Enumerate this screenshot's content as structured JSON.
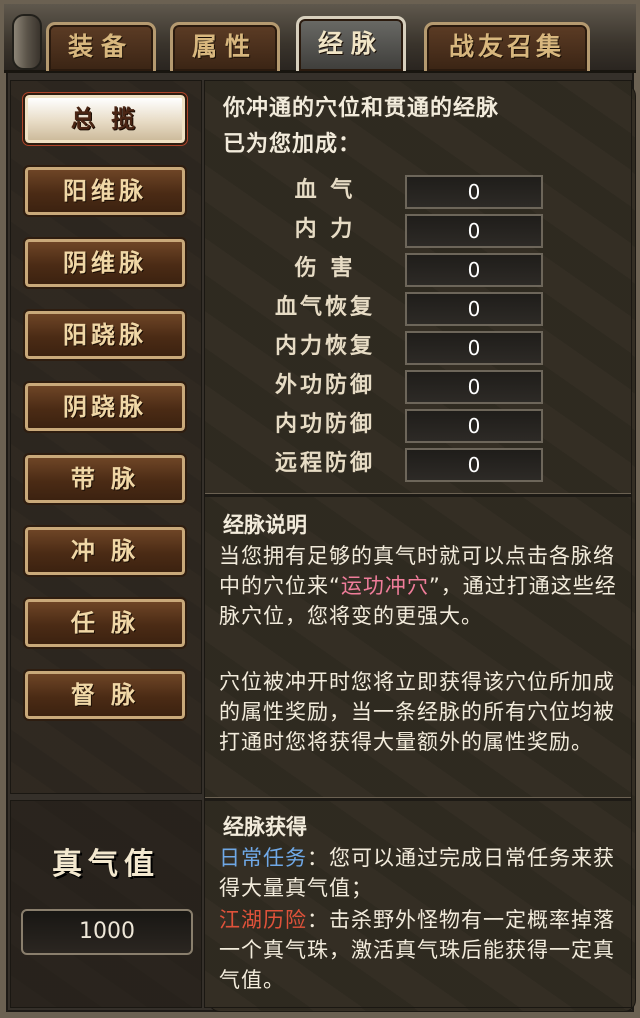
{
  "tabs": [
    {
      "label": "装备",
      "active": false
    },
    {
      "label": "属性",
      "active": false
    },
    {
      "label": "经脉",
      "active": true
    },
    {
      "label": "战友召集",
      "active": false
    }
  ],
  "nav": [
    {
      "label": "总 揽",
      "active": true
    },
    {
      "label": "阳维脉",
      "active": false
    },
    {
      "label": "阴维脉",
      "active": false
    },
    {
      "label": "阳跷脉",
      "active": false
    },
    {
      "label": "阴跷脉",
      "active": false
    },
    {
      "label": "带 脉",
      "active": false
    },
    {
      "label": "冲 脉",
      "active": false
    },
    {
      "label": "任 脉",
      "active": false
    },
    {
      "label": "督 脉",
      "active": false
    }
  ],
  "zhenqi": {
    "title": "真气值",
    "value": "1000"
  },
  "intro": {
    "line1": "你冲通的穴位和贯通的经脉",
    "line2": "已为您加成："
  },
  "stats": [
    {
      "label": "血 气",
      "value": "0"
    },
    {
      "label": "内 力",
      "value": "0"
    },
    {
      "label": "伤 害",
      "value": "0"
    },
    {
      "label": "血气恢复",
      "value": "0"
    },
    {
      "label": "内力恢复",
      "value": "0"
    },
    {
      "label": "外功防御",
      "value": "0"
    },
    {
      "label": "内功防御",
      "value": "0"
    },
    {
      "label": "远程防御",
      "value": "0"
    }
  ],
  "desc": {
    "title": "经脉说明",
    "p1_a": "当您拥有足够的真气时就可以点击各脉络中的穴位来“",
    "p1_link": "运功冲穴",
    "p1_b": "”，通过打通这些经脉穴位，您将变的更强大。",
    "p2": "穴位被冲开时您将立即获得该穴位所加成的属性奖励，当一条经脉的所有穴位均被打通时您将获得大量额外的属性奖励。"
  },
  "obtain": {
    "title": "经脉获得",
    "daily_label": "日常任务",
    "daily_text": "：您可以通过完成日常任务来获得大量真气值；",
    "jianghu_label": "江湖历险",
    "jianghu_text": "：击杀野外怪物有一定概率掉落一个真气珠，激活真气珠后能获得一定真气值。"
  },
  "colors": {
    "accent_pink": "#f07d9a",
    "accent_blue": "#6fa8e6",
    "accent_red": "#e0523a"
  }
}
